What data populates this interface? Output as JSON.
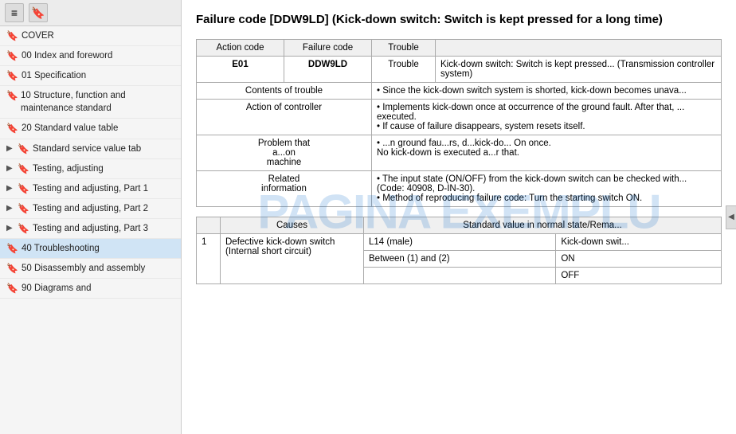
{
  "sidebar": {
    "toolbar": {
      "menu_icon": "☰",
      "bookmark_icon": "🔖"
    },
    "items": [
      {
        "id": "cover",
        "label": "COVER",
        "indent": 0,
        "arrow": "",
        "active": false
      },
      {
        "id": "00-index",
        "label": "00 Index and foreword",
        "indent": 0,
        "arrow": "",
        "active": false
      },
      {
        "id": "01-spec",
        "label": "01 Specification",
        "indent": 0,
        "arrow": "",
        "active": false
      },
      {
        "id": "10-structure",
        "label": "10 Structure, function and maintenance standard",
        "indent": 0,
        "arrow": "",
        "active": false
      },
      {
        "id": "20-standard",
        "label": "20 Standard value table",
        "indent": 0,
        "arrow": "",
        "active": false
      },
      {
        "id": "standard-service",
        "label": "Standard service value tab",
        "indent": 1,
        "arrow": "▶",
        "active": false
      },
      {
        "id": "testing-adjusting",
        "label": "Testing, adjusting",
        "indent": 1,
        "arrow": "▶",
        "active": false
      },
      {
        "id": "testing-adjusting-1",
        "label": "Testing and adjusting, Part 1",
        "indent": 1,
        "arrow": "▶",
        "active": false
      },
      {
        "id": "testing-adjusting-2",
        "label": "Testing and adjusting, Part 2",
        "indent": 1,
        "arrow": "▶",
        "active": false
      },
      {
        "id": "testing-adjusting-3",
        "label": "Testing and adjusting, Part 3",
        "indent": 1,
        "arrow": "▶",
        "active": false
      },
      {
        "id": "40-troubleshooting",
        "label": "40 Troubleshooting",
        "indent": 0,
        "arrow": "",
        "active": true
      },
      {
        "id": "50-disassembly",
        "label": "50 Disassembly and assembly",
        "indent": 0,
        "arrow": "",
        "active": false
      },
      {
        "id": "90-diagrams",
        "label": "90 Diagrams and",
        "indent": 0,
        "arrow": "",
        "active": false
      }
    ]
  },
  "main": {
    "title": "Failure code [DDW9LD] (Kick-down switch: Switch is ke... long time)",
    "title_full": "Failure code [DDW9LD] (Kick-down switch: Switch is kept pressed for a long time)",
    "watermark_line1": "PAGINA EXEMPLU",
    "table1": {
      "headers": [
        "Action code",
        "Failure code",
        "Trouble"
      ],
      "action_code": "E01",
      "failure_code": "DDW9LD",
      "trouble_text": "Kick-down switch: Switch is kept pressed... (Transmission controller system)",
      "rows": [
        {
          "label": "Contents of trouble",
          "content": "Since the kick-down switch system is shorted, kick-down becomes unava..."
        },
        {
          "label": "Action of controller",
          "content": "Implements kick-down once at occurrence of the ground fault. After that,... executed.\nIf cause of failure disappears, system resets itself."
        },
        {
          "label": "Problem that action on machine",
          "content": "...n ground fau...rs, d...kick-do... On once.\nNo kick-down is executed a...r that."
        },
        {
          "label": "Related information",
          "content": "The input state (ON/OFF) from the kick-down switch can be checked with... (Code: 40908, D-IN-30).\nMethod of reproducing failure code: Turn the starting switch ON."
        }
      ]
    },
    "table2": {
      "headers": [
        "Causes",
        "Standard value in normal state/Rema..."
      ],
      "rows": [
        {
          "num": "1",
          "cause": "Defective kick-down switch (Internal short circuit)",
          "sub_rows": [
            {
              "connector": "L14 (male)",
              "label": "Kick-down swit..."
            },
            {
              "connector": "Between (1) and (2)",
              "values": [
                "ON",
                "OFF"
              ]
            }
          ]
        }
      ]
    }
  },
  "icons": {
    "arrow_right": "▶",
    "arrow_left": "◀",
    "bookmark": "🔖",
    "menu": "≡"
  }
}
